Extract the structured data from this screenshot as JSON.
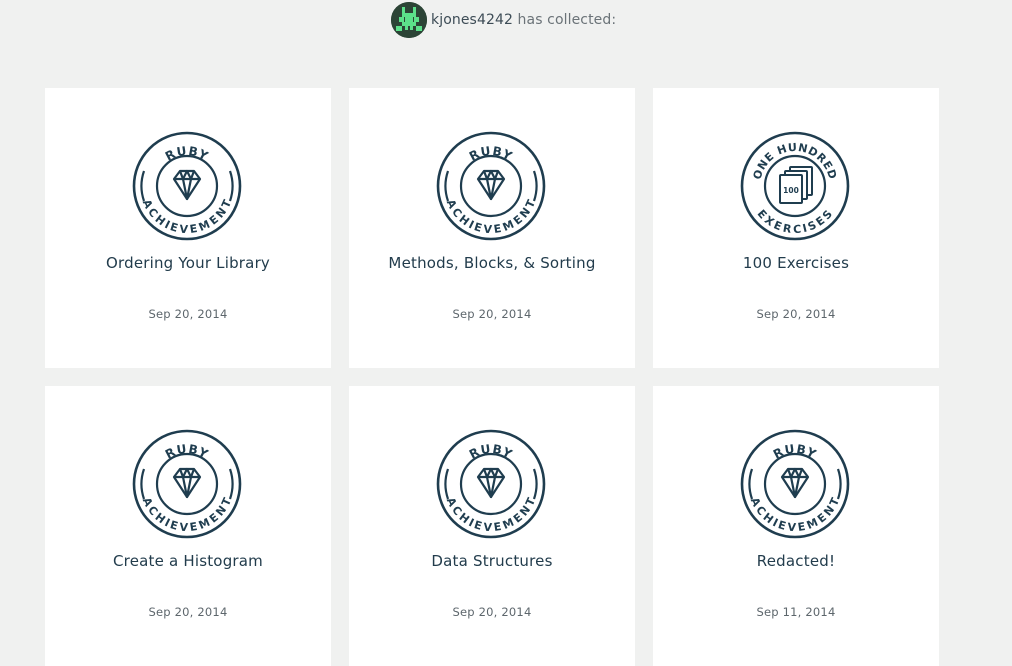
{
  "header": {
    "username": "kjones4242",
    "collected_text": "has collected:"
  },
  "achievements": [
    {
      "title": "Ordering Your Library",
      "date": "Sep 20, 2014",
      "badge_top": "RUBY",
      "badge_bottom": "ACHIEVEMENT",
      "icon": "diamond-icon"
    },
    {
      "title": "Methods, Blocks, & Sorting",
      "date": "Sep 20, 2014",
      "badge_top": "RUBY",
      "badge_bottom": "ACHIEVEMENT",
      "icon": "diamond-icon"
    },
    {
      "title": "100 Exercises",
      "date": "Sep 20, 2014",
      "badge_top": "ONE HUNDRED",
      "badge_bottom": "EXERCISES",
      "badge_number": "100",
      "icon": "document-stack-icon"
    },
    {
      "title": "Create a Histogram",
      "date": "Sep 20, 2014",
      "badge_top": "RUBY",
      "badge_bottom": "ACHIEVEMENT",
      "icon": "diamond-icon"
    },
    {
      "title": "Data Structures",
      "date": "Sep 20, 2014",
      "badge_top": "RUBY",
      "badge_bottom": "ACHIEVEMENT",
      "icon": "diamond-icon"
    },
    {
      "title": "Redacted!",
      "date": "Sep 11, 2014",
      "badge_top": "RUBY",
      "badge_bottom": "ACHIEVEMENT",
      "icon": "diamond-icon"
    }
  ],
  "colors": {
    "badge_stroke": "#1f3d4f",
    "avatar_bg": "#2c4436",
    "avatar_pixel": "#5ce08a"
  }
}
